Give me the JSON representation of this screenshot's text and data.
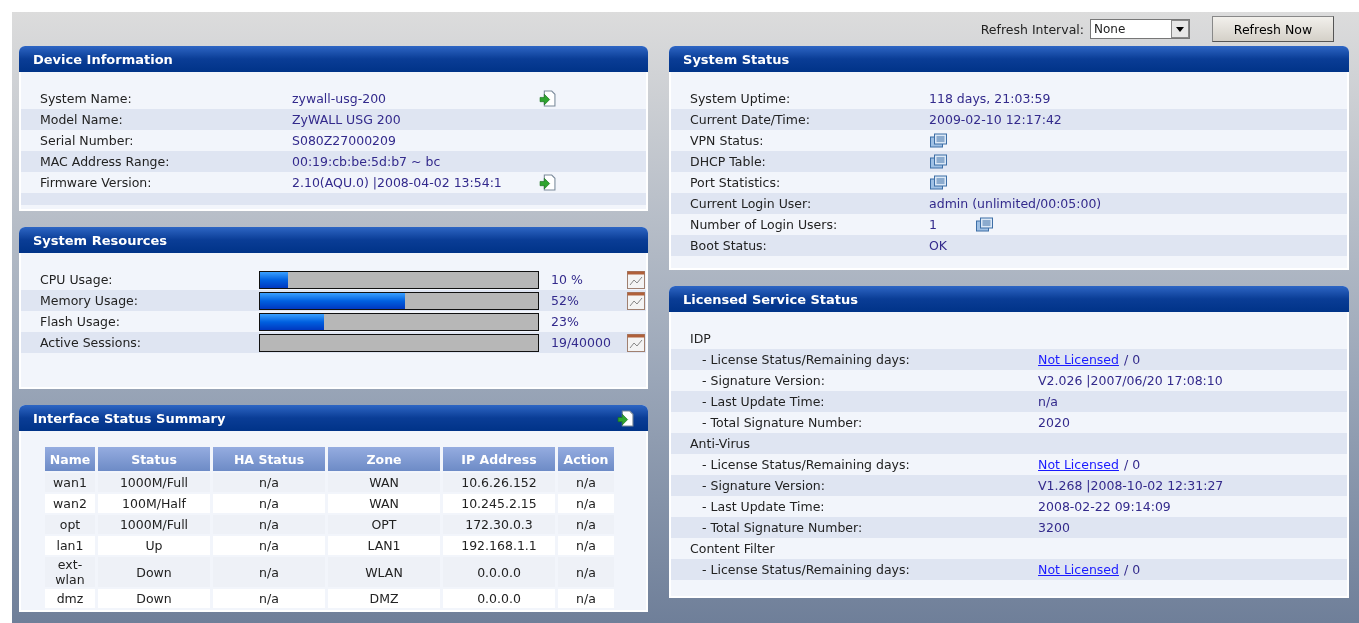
{
  "toolbar": {
    "refresh_label": "Refresh Interval:",
    "refresh_select": {
      "value": "None"
    },
    "refresh_button": "Refresh Now"
  },
  "device_information": {
    "title": "Device Information",
    "rows": [
      {
        "kind": "export",
        "label": "System Name:",
        "value": "zywall-usg-200"
      },
      {
        "kind": "plain",
        "label": "Model Name:",
        "value": "ZyWALL USG 200"
      },
      {
        "kind": "plain",
        "label": "Serial Number:",
        "value": "S080Z27000209"
      },
      {
        "kind": "plain",
        "label": "MAC Address Range:",
        "value": "00:19:cb:be:5d:b7 ~ bc"
      },
      {
        "kind": "export",
        "label": "Firmware Version:",
        "value": "2.10(AQU.0) |2008-04-02 13:54:1"
      }
    ]
  },
  "system_resources": {
    "title": "System Resources",
    "rows": [
      {
        "label": "CPU Usage:",
        "level": 0.1,
        "reading": "10 %",
        "chart_icon": true
      },
      {
        "label": "Memory Usage:",
        "level": 0.52,
        "reading": "52%",
        "chart_icon": true
      },
      {
        "label": "Flash Usage:",
        "level": 0.23,
        "reading": "23%",
        "chart_icon": false
      },
      {
        "label": "Active Sessions:",
        "reading": "19/40000",
        "chart_icon": true
      }
    ]
  },
  "interface_status_summary": {
    "title": "Interface Status Summary",
    "columns": [
      "Name",
      "Status",
      "HA Status",
      "Zone",
      "IP Address",
      "Action"
    ],
    "rows": [
      [
        "wan1",
        "1000M/Full",
        "n/a",
        "WAN",
        "10.6.26.152",
        "n/a"
      ],
      [
        "wan2",
        "100M/Half",
        "n/a",
        "WAN",
        "10.245.2.15",
        "n/a"
      ],
      [
        "opt",
        "1000M/Full",
        "n/a",
        "OPT",
        "172.30.0.3",
        "n/a"
      ],
      [
        "lan1",
        "Up",
        "n/a",
        "LAN1",
        "192.168.1.1",
        "n/a"
      ],
      [
        "ext-wlan",
        "Down",
        "n/a",
        "WLAN",
        "0.0.0.0",
        "n/a"
      ],
      [
        "dmz",
        "Down",
        "n/a",
        "DMZ",
        "0.0.0.0",
        "n/a"
      ]
    ]
  },
  "system_status": {
    "title": "System Status",
    "rows": [
      {
        "kind": "value",
        "label": "System Uptime:",
        "value": "118 days, 21:03:59"
      },
      {
        "kind": "value",
        "label": "Current Date/Time:",
        "value": "2009-02-10 12:17:42"
      },
      {
        "kind": "detail",
        "label": "VPN Status:"
      },
      {
        "kind": "detail",
        "label": "DHCP Table:"
      },
      {
        "kind": "detail",
        "label": "Port Statistics:"
      },
      {
        "kind": "value",
        "label": "Current Login User:",
        "value": "admin (unlimited/00:05:00)"
      },
      {
        "kind": "value_detail",
        "label": "Number of Login Users:",
        "value": "1"
      },
      {
        "kind": "value",
        "label": "Boot Status:",
        "value": "OK"
      }
    ]
  },
  "licensed_service_status": {
    "title": "Licensed Service Status",
    "rows": [
      {
        "kind": "group",
        "label": "IDP"
      },
      {
        "kind": "item",
        "label": "- License Status/Remaining days:",
        "link": "Not Licensed",
        "value": "/ 0"
      },
      {
        "kind": "item",
        "label": "- Signature Version:",
        "value": "V2.026 |2007/06/20 17:08:10"
      },
      {
        "kind": "item",
        "label": "- Last Update Time:",
        "value": "n/a"
      },
      {
        "kind": "item",
        "label": "- Total Signature Number:",
        "value": "2020"
      },
      {
        "kind": "group",
        "label": "Anti-Virus"
      },
      {
        "kind": "item",
        "label": "- License Status/Remaining days:",
        "link": "Not Licensed",
        "value": "/ 0"
      },
      {
        "kind": "item",
        "label": "- Signature Version:",
        "value": "V1.268 |2008-10-02 12:31:27"
      },
      {
        "kind": "item",
        "label": "- Last Update Time:",
        "value": "2008-02-22 09:14:09"
      },
      {
        "kind": "item",
        "label": "- Total Signature Number:",
        "value": "3200"
      },
      {
        "kind": "group",
        "label": "Content Filter"
      },
      {
        "kind": "item",
        "label": "- License Status/Remaining days:",
        "link": "Not Licensed",
        "value": "/ 0"
      }
    ]
  }
}
